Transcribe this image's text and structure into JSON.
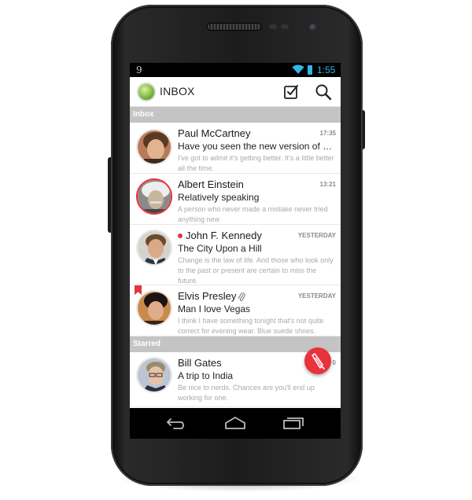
{
  "status_bar": {
    "notification": "9",
    "time": "1:55",
    "accent_color": "#33b5e5"
  },
  "action_bar": {
    "title": "INBOX",
    "logo_icon": "app-logo-icon",
    "actions": [
      "check-square-icon",
      "search-icon"
    ]
  },
  "sections": [
    {
      "label": "Inbox",
      "messages": [
        {
          "sender": "Paul McCartney",
          "time": "17:35",
          "subject": "Have you seen the new version of Mi...",
          "preview": "I've got to admit it's getting better. It's a little better all the time.",
          "unread": false,
          "attachment": false,
          "bookmarked": false,
          "highlight": false
        },
        {
          "sender": "Albert Einstein",
          "time": "13:21",
          "subject": "Relatively speaking",
          "preview": "A person who never made a mistake never tried anything new",
          "unread": false,
          "attachment": false,
          "bookmarked": false,
          "highlight": true
        },
        {
          "sender": "John F. Kennedy",
          "time": "YESTERDAY",
          "subject": "The City Upon a Hill",
          "preview": "Change is the law of life. And those who look only to the past or present are certain to miss the future.",
          "unread": true,
          "attachment": false,
          "bookmarked": false,
          "highlight": false
        },
        {
          "sender": "Elvis Presley",
          "time": "YESTERDAY",
          "subject": "Man I love Vegas",
          "preview": "I think I have something tonight that's not quite correct for evening wear. Blue suede shoes.",
          "unread": false,
          "attachment": true,
          "bookmarked": true,
          "highlight": false
        }
      ]
    },
    {
      "label": "Starred",
      "messages": [
        {
          "sender": "Bill Gates",
          "time": "0",
          "subject": "A trip to India",
          "preview": "Be nice to nerds. Chances are you'll end up working for one.",
          "unread": false,
          "attachment": false,
          "bookmarked": false,
          "highlight": false
        }
      ]
    }
  ],
  "fab": {
    "icon": "compose-pen-icon",
    "color": "#e8323c"
  },
  "nav_bar": {
    "buttons": [
      "back-icon",
      "home-icon",
      "recent-apps-icon"
    ]
  },
  "colors": {
    "section_header": "#c4c4c4",
    "accent_red": "#e8323c"
  }
}
